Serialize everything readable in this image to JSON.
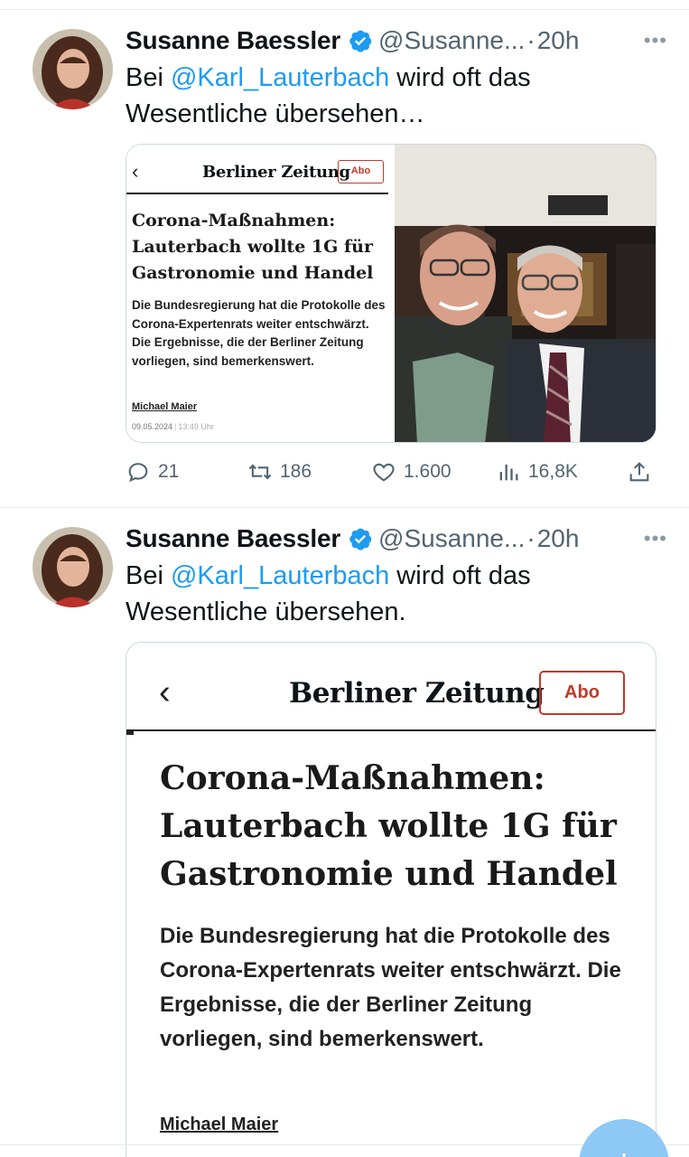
{
  "tweets": [
    {
      "author_name": "Susanne Baessler",
      "handle": "@Susanne...",
      "separator": "·",
      "time": "20h",
      "more": "•••",
      "text_prefix": "Bei ",
      "mention": "@Karl_Lauterbach",
      "text_suffix": " wird oft das Wesentliche übersehen…",
      "card": {
        "back": "‹",
        "logo": "Berliner Zeitung",
        "abo": "Abo",
        "headline": "Corona-Maßnahmen: Lauterbach wollte 1G für Gastronomie und Handel",
        "teaser": "Die Bundesregierung hat die Protokolle des Corona-Expertenrats weiter entschwärzt. Die Ergebnisse, die der Berliner Zeitung vorliegen, sind bemerkenswert.",
        "author": "Michael Maier",
        "date": "09.05.2024",
        "date_sep": "|",
        "hour": "13:49 Uhr"
      },
      "actions": {
        "replies": "21",
        "retweets": "186",
        "likes": "1.600",
        "views": "16,8K"
      }
    },
    {
      "author_name": "Susanne Baessler",
      "handle": "@Susanne...",
      "separator": "·",
      "time": "20h",
      "more": "•••",
      "text_prefix": "Bei ",
      "mention": "@Karl_Lauterbach",
      "text_suffix": " wird oft das Wesentliche übersehen.",
      "card": {
        "back": "‹",
        "logo": "Berliner Zeitung",
        "abo": "Abo",
        "headline": "Corona-Maßnahmen: Lauterbach wollte 1G für Gastronomie und Handel",
        "teaser": "Die Bundesregierung hat die Protokolle des Corona-Expertenrats weiter entschwärzt. Die Ergebnisse, die der Berliner Zeitung vorliegen, sind bemerkenswert.",
        "author": "Michael Maier"
      }
    }
  ],
  "fab_label": "+",
  "icons": {
    "verified": "verified-badge-icon",
    "reply": "reply-icon",
    "retweet": "retweet-icon",
    "like": "heart-icon",
    "views": "views-chart-icon",
    "share": "share-icon"
  },
  "colors": {
    "mention": "#1d9bf0",
    "secondary_text": "#536471",
    "abo_red": "#c0392b",
    "verified_blue": "#1d9bf0"
  }
}
